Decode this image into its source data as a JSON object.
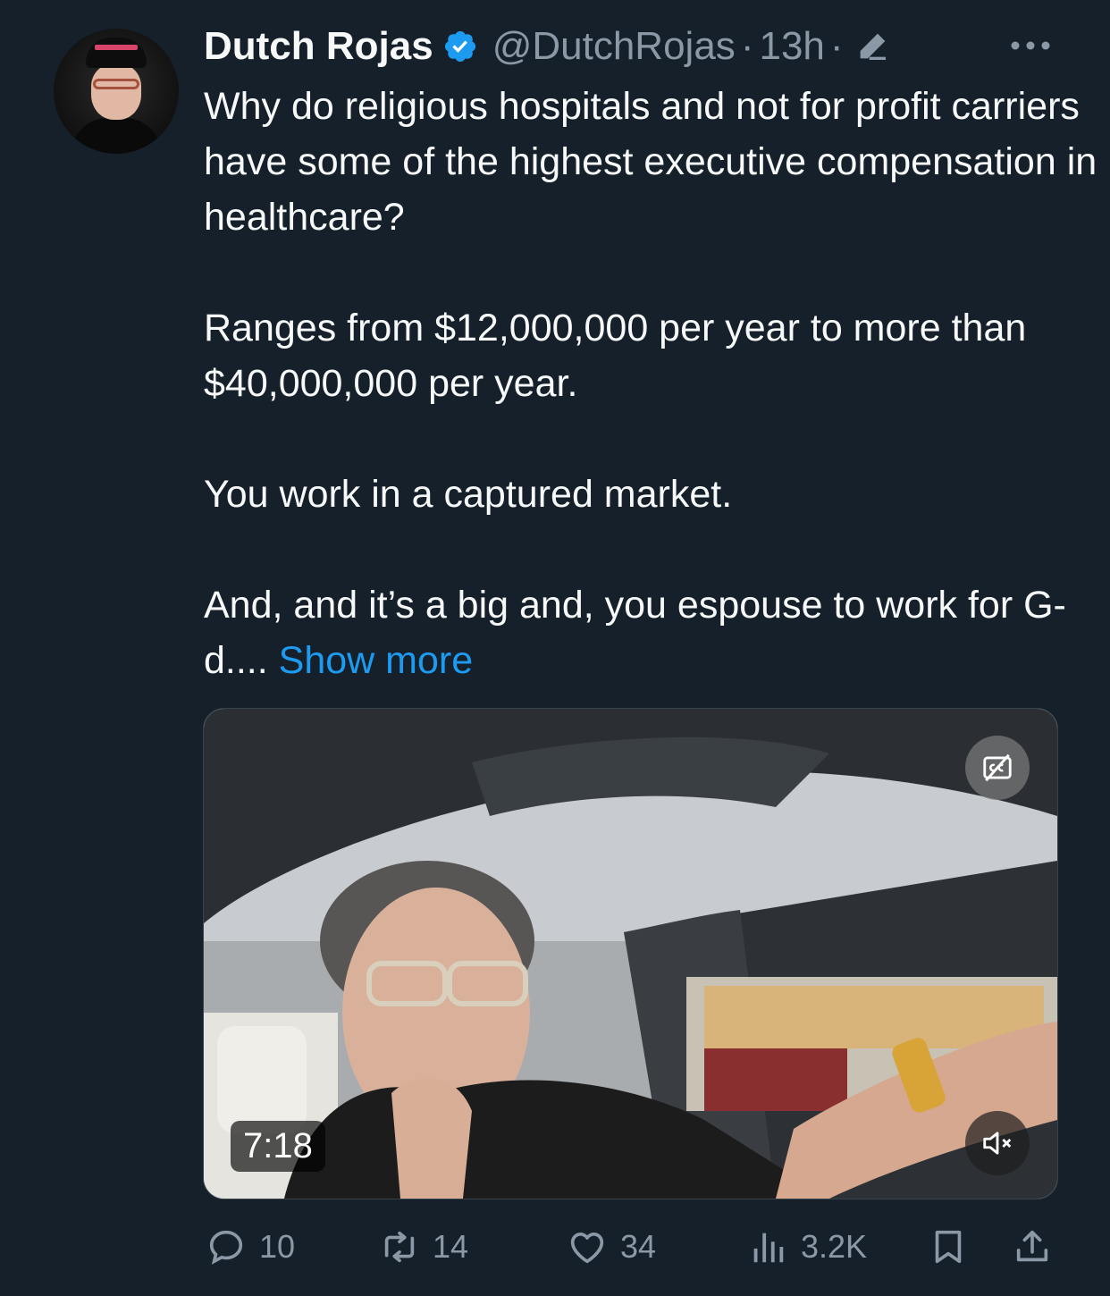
{
  "author": {
    "name": "Dutch Rojas",
    "handle": "@DutchRojas",
    "time": "13h",
    "separator": "·"
  },
  "tweet": {
    "paragraphs": [
      "Why do religious hospitals and not for profit carriers have some of the highest executive compensation in healthcare?",
      "Ranges from $12,000,000 per year to more than $40,000,000 per year.",
      "You work in a captured market.",
      "And, and it’s a big and, you espouse to work for G-d...."
    ],
    "show_more": "Show more"
  },
  "media": {
    "duration": "7:18"
  },
  "stats": {
    "replies": "10",
    "reposts": "14",
    "likes": "34",
    "views": "3.2K"
  },
  "icons": [
    "verified-badge-icon",
    "edit-icon",
    "more-icon",
    "cc-icon",
    "mute-icon",
    "reply-icon",
    "repost-icon",
    "like-icon",
    "views-icon",
    "bookmark-icon",
    "share-icon"
  ],
  "colors": {
    "background": "#15202b",
    "text": "#f7f9f9",
    "muted": "#8b98a5",
    "accent": "#1d9bf0"
  }
}
